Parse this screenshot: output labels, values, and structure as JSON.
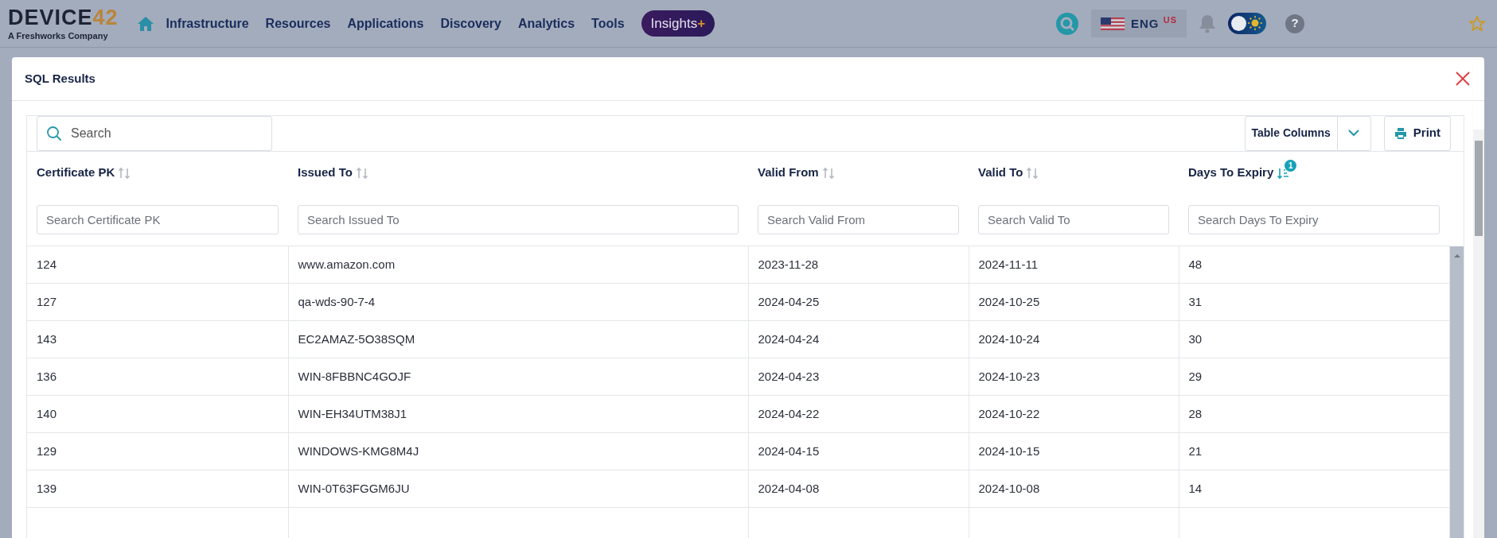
{
  "logo": {
    "name": "DEVICE",
    "number": "42",
    "tagline": "A Freshworks Company"
  },
  "nav": [
    {
      "label": "Infrastructure"
    },
    {
      "label": "Resources"
    },
    {
      "label": "Applications"
    },
    {
      "label": "Discovery"
    },
    {
      "label": "Analytics"
    },
    {
      "label": "Tools"
    }
  ],
  "insights": {
    "label": "Insights",
    "plus": "+"
  },
  "language": {
    "code": "ENG",
    "region": "US"
  },
  "dark_mode": false,
  "help": "?",
  "modal": {
    "title": "SQL Results"
  },
  "search": {
    "placeholder": "Search"
  },
  "table_columns_button": "Table Columns",
  "print_button": "Print",
  "columns": [
    {
      "label": "Certificate PK",
      "sorted": false,
      "filter_placeholder": "Search Certificate PK"
    },
    {
      "label": "Issued To",
      "sorted": false,
      "filter_placeholder": "Search Issued To"
    },
    {
      "label": "Valid From",
      "sorted": false,
      "filter_placeholder": "Search Valid From"
    },
    {
      "label": "Valid To",
      "sorted": false,
      "filter_placeholder": "Search Valid To"
    },
    {
      "label": "Days To Expiry",
      "sorted": true,
      "sort_rank": "1",
      "filter_placeholder": "Search Days To Expiry"
    }
  ],
  "rows": [
    [
      "124",
      "www.amazon.com",
      "2023-11-28",
      "2024-11-11",
      "48"
    ],
    [
      "127",
      "qa-wds-90-7-4",
      "2024-04-25",
      "2024-10-25",
      "31"
    ],
    [
      "143",
      "EC2AMAZ-5O38SQM",
      "2024-04-24",
      "2024-10-24",
      "30"
    ],
    [
      "136",
      "WIN-8FBBNC4GOJF",
      "2024-04-23",
      "2024-10-23",
      "29"
    ],
    [
      "140",
      "WIN-EH34UTM38J1",
      "2024-04-22",
      "2024-10-22",
      "28"
    ],
    [
      "129",
      "WINDOWS-KMG8M4J",
      "2024-04-15",
      "2024-10-15",
      "21"
    ],
    [
      "139",
      "WIN-0T63FGGM6JU",
      "2024-04-08",
      "2024-10-08",
      "14"
    ]
  ]
}
